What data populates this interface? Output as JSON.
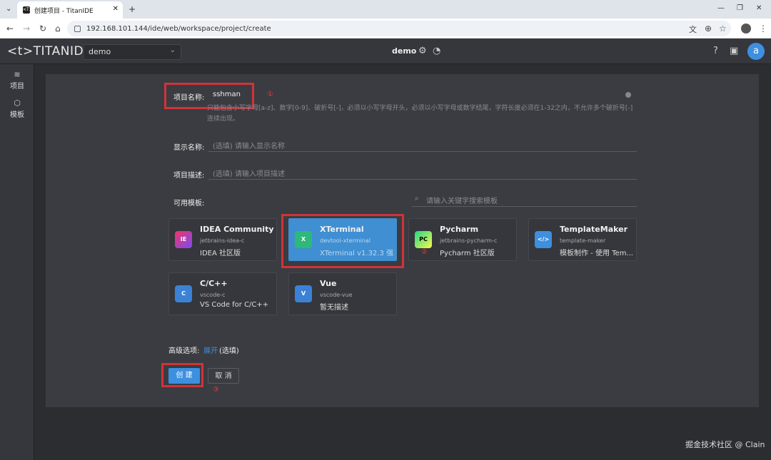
{
  "browser": {
    "tab_title": "创建项目 - TitanIDE",
    "favicon": "<T>",
    "url": "192.168.101.144/ide/web/workspace/project/create"
  },
  "header": {
    "logo": "<t>TITANIDE",
    "workspace": "demo",
    "title": "demo",
    "avatar": "a"
  },
  "sidebar": {
    "items": [
      {
        "label": "项目",
        "icon": "layers-icon"
      },
      {
        "label": "模板",
        "icon": "cube-icon"
      }
    ]
  },
  "form": {
    "name_label": "项目名称:",
    "name_value": "sshman",
    "name_hint": "只能包含小写字母[a-z]、数字[0-9]、破折号[-]，必须以小写字母开头，必须以小写字母或数字结尾，字符长度必须在1-32之内，不允许多个破折号[-]连续出现。",
    "display_label": "显示名称:",
    "display_placeholder": "(选填) 请输入显示名称",
    "desc_label": "项目描述:",
    "desc_placeholder": "(选填) 请输入项目描述",
    "templates_label": "可用模板:",
    "search_placeholder": "请输入关键字搜索模板",
    "advanced_label": "高级选项:",
    "advanced_link": "展开",
    "advanced_note": "(选填)",
    "create_button": "创 建",
    "cancel_button": "取 消"
  },
  "templates": [
    {
      "title": "IDEA Community",
      "id": "jetbrains-idea-c",
      "desc": "IDEA 社区版",
      "icon": "IE",
      "color": "#b0389a",
      "selected": false
    },
    {
      "title": "XTerminal",
      "id": "devtool-xterminal",
      "desc": "XTerminal v1.32.3 强...",
      "icon": "X",
      "color": "#2eb87a",
      "selected": true
    },
    {
      "title": "Pycharm",
      "id": "jetbrains-pycharm-c",
      "desc": "Pycharm 社区版",
      "icon": "PC",
      "color": "#21c170",
      "selected": false
    },
    {
      "title": "TemplateMaker",
      "id": "template-maker",
      "desc": "模板制作 - 使用 Tem...",
      "icon": "</>",
      "color": "#3d8fe0",
      "selected": false
    },
    {
      "title": "C/C++",
      "id": "vscode-c",
      "desc": "VS Code for C/C++",
      "icon": "C",
      "color": "#3b82d6",
      "selected": false
    },
    {
      "title": "Vue",
      "id": "vscode-vue",
      "desc": "暂无描述",
      "icon": "V",
      "color": "#3b82d6",
      "selected": false
    }
  ],
  "annotations": {
    "m1": "①",
    "m2": "②",
    "m3": "③"
  },
  "watermark": "掘金技术社区 @ Clain"
}
